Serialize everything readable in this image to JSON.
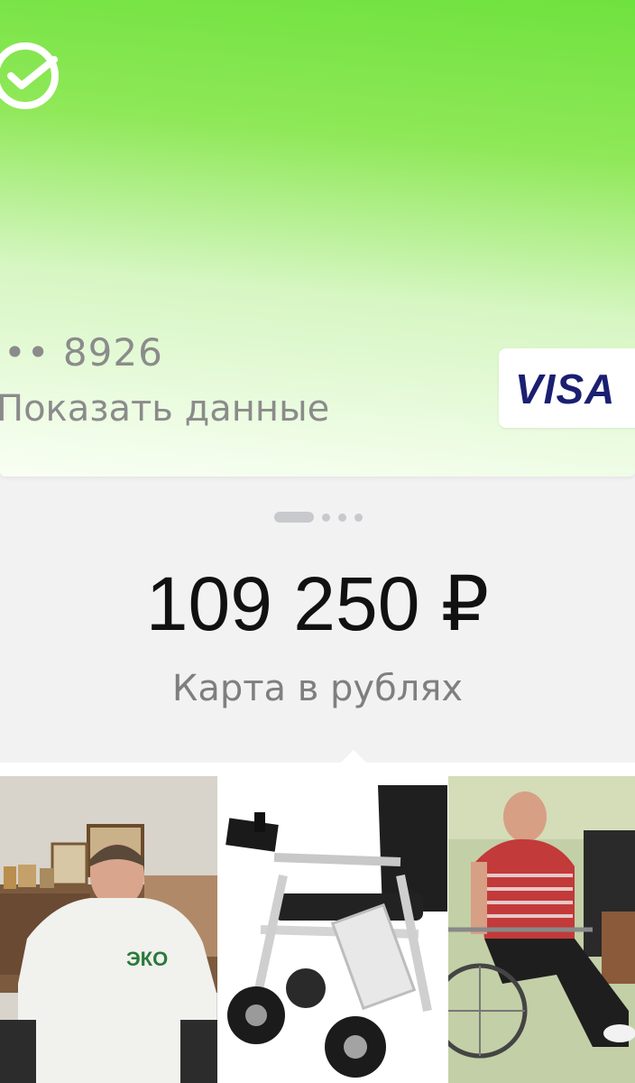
{
  "card": {
    "bank_logo_icon": "sber-check-icon",
    "masked_number": "•• 8926",
    "show_data_label": "Показать данные",
    "payment_system": "VISA",
    "gradient_colors": [
      "#6fe23e",
      "#d6f6c2",
      "#f9fff4"
    ]
  },
  "pager": {
    "total": 4,
    "active_index": 0
  },
  "account": {
    "balance": "109 250 ₽",
    "currency_label": "Карта в рублях"
  },
  "photos": [
    {
      "name": "man-in-wheelchair-photo"
    },
    {
      "name": "electric-wheelchair-photo"
    },
    {
      "name": "elderly-man-in-wheelchair-photo"
    }
  ]
}
